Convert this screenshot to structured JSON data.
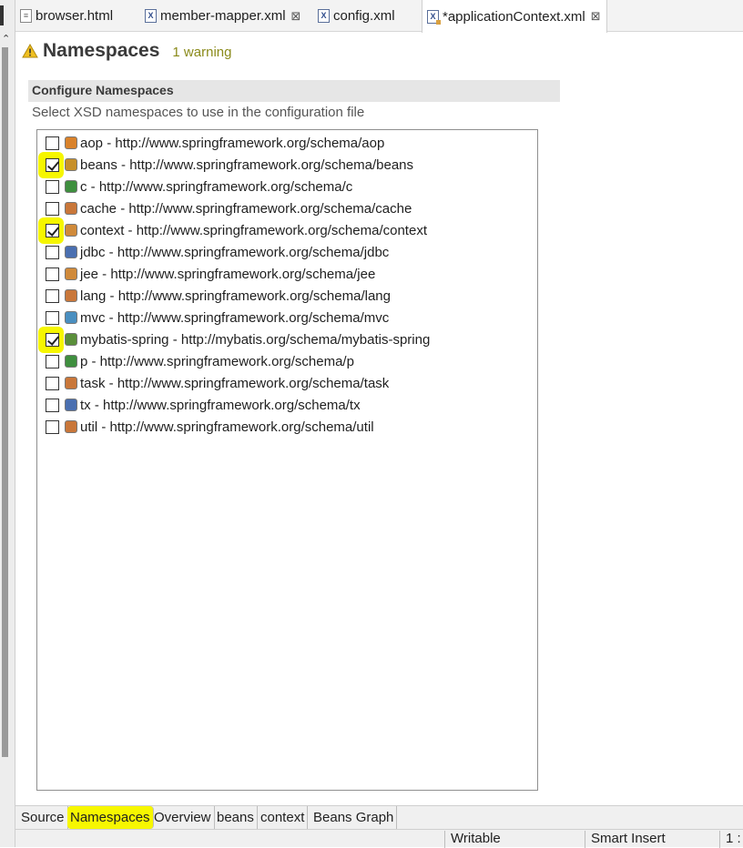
{
  "tabs": [
    {
      "label": "browser.html",
      "icon": "html-file-icon",
      "active": false,
      "closable": false
    },
    {
      "label": "member-mapper.xml",
      "icon": "xml-file-icon",
      "active": false,
      "closable": true
    },
    {
      "label": "config.xml",
      "icon": "xml-file-icon",
      "active": false,
      "closable": false
    },
    {
      "label": "*applicationContext.xml",
      "icon": "spring-xml-file-icon",
      "active": true,
      "closable": true
    }
  ],
  "close_glyph": "⊠",
  "header": {
    "title": "Namespaces",
    "warning": "1 warning"
  },
  "section": {
    "title": "Configure Namespaces",
    "description": "Select XSD namespaces to use in the configuration file"
  },
  "namespaces": [
    {
      "label": "aop - http://www.springframework.org/schema/aop",
      "checked": false,
      "highlighted": false,
      "icon": "aop-icon",
      "color": "#d9822b"
    },
    {
      "label": "beans - http://www.springframework.org/schema/beans",
      "checked": true,
      "highlighted": true,
      "icon": "bean-icon",
      "color": "#c7902a"
    },
    {
      "label": "c - http://www.springframework.org/schema/c",
      "checked": false,
      "highlighted": false,
      "icon": "c-namespace-icon",
      "color": "#3f8f3f"
    },
    {
      "label": "cache - http://www.springframework.org/schema/cache",
      "checked": false,
      "highlighted": false,
      "icon": "cache-icon",
      "color": "#c9773a"
    },
    {
      "label": "context - http://www.springframework.org/schema/context",
      "checked": true,
      "highlighted": true,
      "icon": "context-icon",
      "color": "#d08a3a"
    },
    {
      "label": "jdbc - http://www.springframework.org/schema/jdbc",
      "checked": false,
      "highlighted": false,
      "icon": "jdbc-icon",
      "color": "#4a6fb0"
    },
    {
      "label": "jee - http://www.springframework.org/schema/jee",
      "checked": false,
      "highlighted": false,
      "icon": "jee-icon",
      "color": "#d08a3a"
    },
    {
      "label": "lang - http://www.springframework.org/schema/lang",
      "checked": false,
      "highlighted": false,
      "icon": "lang-icon",
      "color": "#c9773a"
    },
    {
      "label": "mvc - http://www.springframework.org/schema/mvc",
      "checked": false,
      "highlighted": false,
      "icon": "mvc-globe-icon",
      "color": "#4a8fc0"
    },
    {
      "label": "mybatis-spring - http://mybatis.org/schema/mybatis-spring",
      "checked": true,
      "highlighted": true,
      "icon": "mybatis-spring-icon",
      "color": "#5a8f3a"
    },
    {
      "label": "p - http://www.springframework.org/schema/p",
      "checked": false,
      "highlighted": false,
      "icon": "p-namespace-icon",
      "color": "#3f8f3f"
    },
    {
      "label": "task - http://www.springframework.org/schema/task",
      "checked": false,
      "highlighted": false,
      "icon": "task-icon",
      "color": "#c9773a"
    },
    {
      "label": "tx - http://www.springframework.org/schema/tx",
      "checked": false,
      "highlighted": false,
      "icon": "tx-icon",
      "color": "#4a6fb0"
    },
    {
      "label": "util - http://www.springframework.org/schema/util",
      "checked": false,
      "highlighted": false,
      "icon": "util-icon",
      "color": "#c9773a"
    }
  ],
  "page_tabs": [
    {
      "label": "Source",
      "active": false
    },
    {
      "label": "Namespaces",
      "active": true
    },
    {
      "label": "Overview",
      "active": false
    },
    {
      "label": "beans",
      "active": false
    },
    {
      "label": "context",
      "active": false
    },
    {
      "label": "Beans Graph",
      "active": false
    }
  ],
  "status": {
    "writable": "Writable",
    "insert_mode": "Smart Insert",
    "position": "1 :"
  },
  "colors": {
    "highlight": "#f6f600",
    "warning_text": "#8a8a1a",
    "warning_icon": "#f0c020"
  }
}
